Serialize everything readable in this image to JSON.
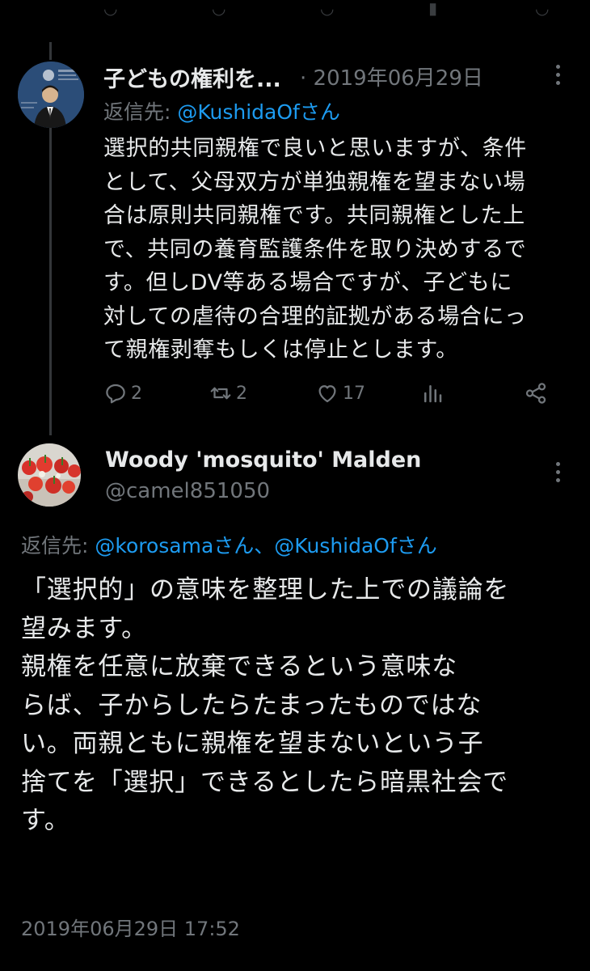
{
  "tweet1": {
    "author_name": "子どもの権利を...",
    "date": "· 2019年06月29日",
    "reply_prefix": "返信先: ",
    "reply_handle": "@KushidaOfさん",
    "body": "選択的共同親権で良いと思いますが、条件\nとして、父母双方が単独親権を望まない場\n合は原則共同親権です。共同親権とした上\nで、共同の養育監護条件を取り決めするで\nす。但しDV等ある場合ですが、子どもに\n対しての虐待の合理的証拠がある場合にっ\nて親権剥奪もしくは停止とします。",
    "reply_count": "2",
    "retweet_count": "2",
    "like_count": "17"
  },
  "tweet2": {
    "author_name": "Woody 'mosquito' Malden",
    "author_handle": "@camel851050",
    "reply_prefix": "返信先: ",
    "reply_handles": "@korosamaさん、@KushidaOfさん",
    "body": "「選択的」の意味を整理した上での議論を\n望みます。\n親権を任意に放棄できるという意味な\nらば、子からしたらたまったものではな\nい。両親ともに親権を望まないという子\n捨てを「選択」できるとしたら暗黒社会で\nす。",
    "timestamp": "2019年06月29日 17:52"
  },
  "colors": {
    "background": "#000000",
    "text": "#e7e9ea",
    "muted": "#71767b",
    "link": "#1d9bf0"
  },
  "icons": [
    "more-icon",
    "reply-icon",
    "retweet-icon",
    "like-icon",
    "views-icon",
    "share-icon"
  ]
}
